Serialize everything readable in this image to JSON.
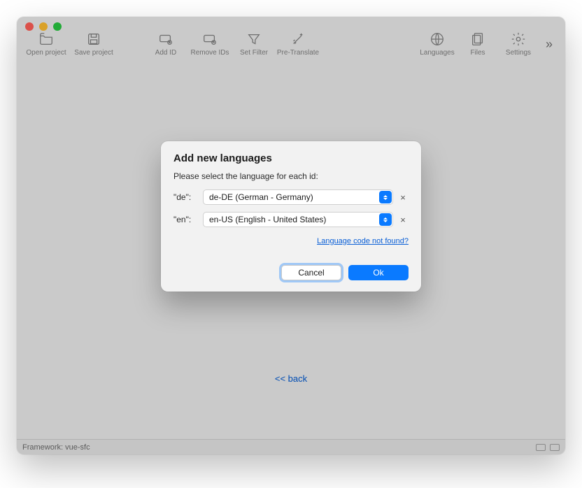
{
  "toolbar": {
    "open_project": "Open project",
    "save_project": "Save project",
    "add_id": "Add ID",
    "remove_ids": "Remove IDs",
    "set_filter": "Set Filter",
    "pre_translate": "Pre-Translate",
    "languages": "Languages",
    "files": "Files",
    "settings": "Settings"
  },
  "back_link": "<< back",
  "statusbar": {
    "framework": "Framework: vue-sfc"
  },
  "dialog": {
    "title": "Add new languages",
    "subtitle": "Please select the language for each id:",
    "rows": [
      {
        "id": "\"de\":",
        "value": "de-DE (German - Germany)"
      },
      {
        "id": "\"en\":",
        "value": "en-US (English - United States)"
      }
    ],
    "help_link": "Language code not found?",
    "cancel": "Cancel",
    "ok": "Ok"
  }
}
